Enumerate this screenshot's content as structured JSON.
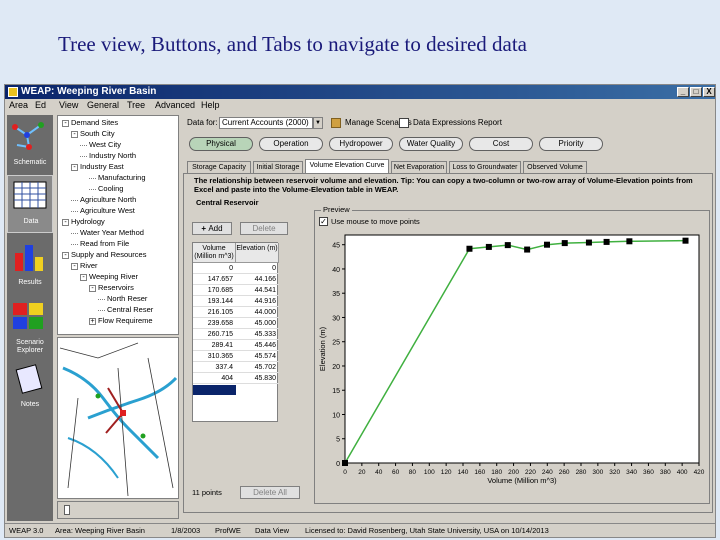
{
  "slide_title": "Tree view, Buttons, and Tabs to navigate to desired data",
  "window": {
    "title": "WEAP: Weeping River Basin",
    "controls": [
      "_",
      "□",
      "X"
    ]
  },
  "menu": [
    "Area",
    "Ed",
    "View",
    "General",
    "Tree",
    "Advanced",
    "Help"
  ],
  "views": [
    {
      "label": "Schematic",
      "icon": "schematic-icon"
    },
    {
      "label": "Data",
      "icon": "data-icon"
    },
    {
      "label": "Results",
      "icon": "results-icon"
    },
    {
      "label": "Scenario Explorer",
      "icon": "scenario-explorer-icon"
    },
    {
      "label": "Notes",
      "icon": "notes-icon"
    }
  ],
  "tree": [
    {
      "label": "Demand Sites",
      "indent": 0,
      "box": "-"
    },
    {
      "label": "South City",
      "indent": 1,
      "box": "-"
    },
    {
      "label": "West City",
      "indent": 2,
      "box": ""
    },
    {
      "label": "Industry North",
      "indent": 2,
      "box": ""
    },
    {
      "label": "Industry East",
      "indent": 1,
      "box": "-"
    },
    {
      "label": "Manufacturing",
      "indent": 3,
      "box": ""
    },
    {
      "label": "Cooling",
      "indent": 3,
      "box": ""
    },
    {
      "label": "Agriculture North",
      "indent": 1,
      "box": ""
    },
    {
      "label": "Agriculture West",
      "indent": 1,
      "box": ""
    },
    {
      "label": "Hydrology",
      "indent": 0,
      "box": "-"
    },
    {
      "label": "Water Year Method",
      "indent": 1,
      "box": ""
    },
    {
      "label": "Read from File",
      "indent": 1,
      "box": ""
    },
    {
      "label": "Supply and Resources",
      "indent": 0,
      "box": "-"
    },
    {
      "label": "River",
      "indent": 1,
      "box": "-"
    },
    {
      "label": "Weeping River",
      "indent": 2,
      "box": "-"
    },
    {
      "label": "Reservoirs",
      "indent": 3,
      "box": "-"
    },
    {
      "label": "North Reser",
      "indent": 4,
      "box": ""
    },
    {
      "label": "Central Reser",
      "indent": 4,
      "box": ""
    },
    {
      "label": "Flow Requireme",
      "indent": 3,
      "box": "+"
    }
  ],
  "toolbar": {
    "data_for_label": "Data for:",
    "scenario_value": "Current Accounts (2000)",
    "manage_scenarios": "Manage Scenarios",
    "data_expressions_report": "Data Expressions Report"
  },
  "category_buttons": [
    {
      "label": "Physical",
      "selected": true
    },
    {
      "label": "Operation",
      "selected": false
    },
    {
      "label": "Hydropower",
      "selected": false
    },
    {
      "label": "Water Quality",
      "selected": false
    },
    {
      "label": "Cost",
      "selected": false
    },
    {
      "label": "Priority",
      "selected": false
    }
  ],
  "tabs": [
    {
      "label": "Storage Capacity",
      "active": false
    },
    {
      "label": "Initial Storage",
      "active": false
    },
    {
      "label": "Volume Elevation Curve",
      "active": true
    },
    {
      "label": "Net Evaporation",
      "active": false
    },
    {
      "label": "Loss to Groundwater",
      "active": false
    },
    {
      "label": "Observed Volume",
      "active": false
    }
  ],
  "description": "The relationship between reservoir volume and elevation. Tip: You can copy a two-column or two-row array of Volume-Elevation points from Excel and paste into the Volume-Elevation table in WEAP.",
  "reservoir_name": "Central Reservoir",
  "add_button": "Add",
  "delete_button": "Delete",
  "delete_all_button": "Delete All",
  "points_count": "11 points",
  "table": {
    "col_volume": "Volume (Million m^3)",
    "col_elevation": "Elevation (m)",
    "rows": [
      [
        "0",
        "0"
      ],
      [
        "147.657",
        "44.166"
      ],
      [
        "170.685",
        "44.541"
      ],
      [
        "193.144",
        "44.916"
      ],
      [
        "216.105",
        "44.000"
      ],
      [
        "239.658",
        "45.000"
      ],
      [
        "260.715",
        "45.333"
      ],
      [
        "289.41",
        "45.446"
      ],
      [
        "310.365",
        "45.574"
      ],
      [
        "337.4",
        "45.702"
      ],
      [
        "404",
        "45.830"
      ]
    ]
  },
  "preview": {
    "title": "Preview",
    "use_mouse_label": "Use mouse to move points",
    "use_mouse_checked": true
  },
  "chart_data": {
    "type": "line",
    "x": [
      0,
      147.657,
      170.685,
      193.144,
      216.105,
      239.658,
      260.715,
      289.41,
      310.365,
      337.4,
      404
    ],
    "y": [
      0,
      44.166,
      44.541,
      44.916,
      44.0,
      45.0,
      45.333,
      45.446,
      45.574,
      45.702,
      45.83
    ],
    "xlabel": "Volume (Million m^3)",
    "ylabel": "Elevation (m)",
    "xlim": [
      0,
      420
    ],
    "ylim": [
      0,
      47
    ],
    "xticks": [
      0,
      20,
      40,
      60,
      80,
      100,
      120,
      140,
      160,
      180,
      200,
      220,
      240,
      260,
      280,
      300,
      320,
      340,
      360,
      380,
      400,
      420
    ],
    "xtick_labels": [
      "0",
      "20",
      "40",
      "60",
      "80",
      "100",
      "120",
      "140",
      "160",
      "180",
      "200",
      "220",
      "240",
      "260",
      "280",
      "300",
      "320",
      "340",
      "360",
      "380",
      "400",
      "420"
    ],
    "yticks": [
      0,
      5,
      10,
      15,
      20,
      25,
      30,
      35,
      40,
      45
    ],
    "grid": false,
    "line_color": "#40b040",
    "marker_color": "#000000"
  },
  "status": {
    "version": "WEAP 3.0",
    "area": "Area: Weeping River Basin",
    "date": "1/8/2003",
    "user": "ProfWE",
    "view": "Data View",
    "license": "Licensed to: David Rosenberg, Utah State University, USA on 10/14/2013"
  }
}
